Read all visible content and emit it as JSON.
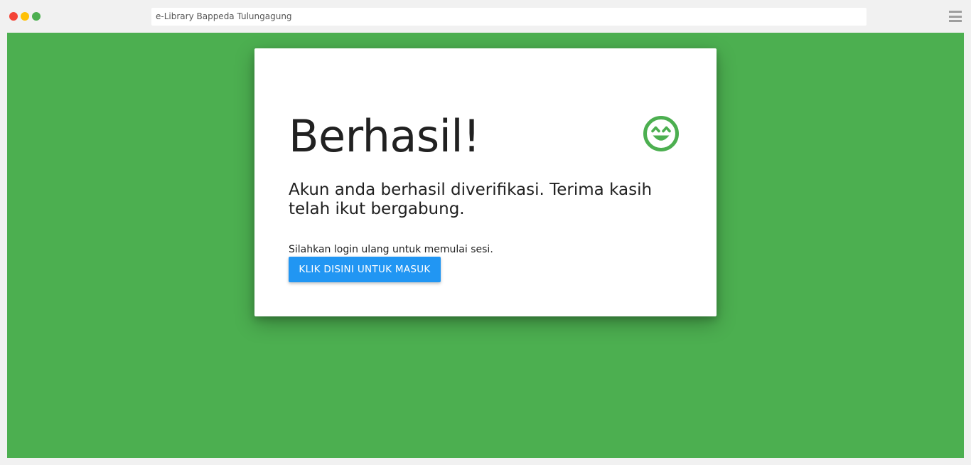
{
  "browser": {
    "address": "e-Library Bappeda Tulungagung",
    "menu_icon": "hamburger-menu-icon",
    "traffic_lights": [
      "#f44336",
      "#ffc107",
      "#4caf50"
    ]
  },
  "page": {
    "background_color": "#4caf50"
  },
  "card": {
    "title": "Berhasil!",
    "icon": "smiling-face-icon",
    "icon_color": "#4caf50",
    "message": "Akun anda berhasil diverifikasi. Terima kasih telah ikut bergabung.",
    "hint": "Silahkan login ulang untuk memulai sesi.",
    "button_label": "KLIK DISINI UNTUK MASUK",
    "button_color": "#2196f3"
  }
}
